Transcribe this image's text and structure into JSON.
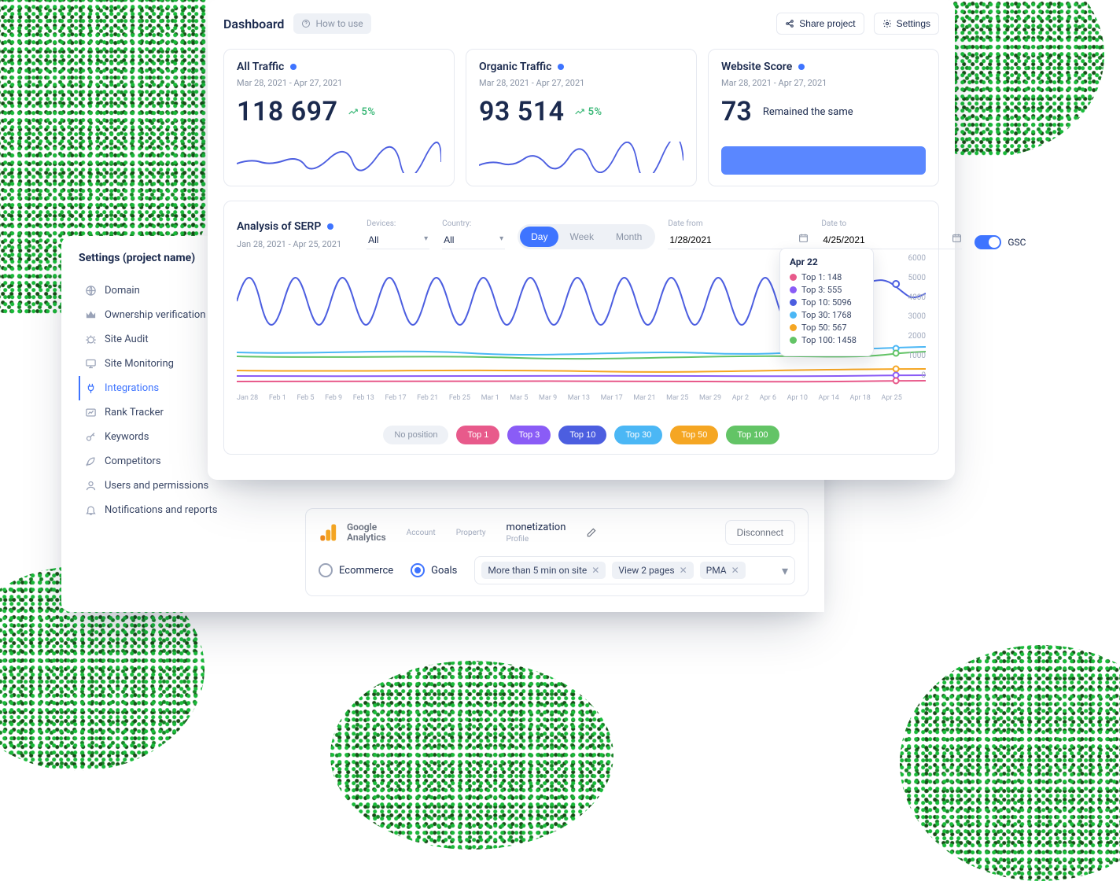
{
  "dashboard": {
    "title": "Dashboard",
    "how_to_use": "How to use",
    "share": "Share project",
    "settings": "Settings"
  },
  "metrics": {
    "all_traffic": {
      "title": "All Traffic",
      "date": "Mar 28, 2021 - Apr 27, 2021",
      "value": "118 697",
      "trend": "5%"
    },
    "organic_traffic": {
      "title": "Organic Traffic",
      "date": "Mar 28, 2021 - Apr 27, 2021",
      "value": "93 514",
      "trend": "5%"
    },
    "score": {
      "title": "Website Score",
      "date": "Mar 28, 2021 - Apr 27, 2021",
      "value": "73",
      "status": "Remained the same"
    }
  },
  "serp": {
    "title": "Analysis of SERP",
    "date_range": "Jan 28, 2021 - Apr 25, 2021",
    "filters": {
      "devices_label": "Devices:",
      "devices_value": "All",
      "country_label": "Country:",
      "country_value": "All",
      "date_from_label": "Date from",
      "date_from_value": "1/28/2021",
      "date_to_label": "Date to",
      "date_to_value": "4/25/2021",
      "gsc_label": "GSC",
      "period": {
        "day": "Day",
        "week": "Week",
        "month": "Month"
      }
    },
    "tooltip": {
      "date": "Apr 22",
      "items": [
        {
          "label": "Top 1: 148",
          "color": "#e85a8b"
        },
        {
          "label": "Top 3: 555",
          "color": "#8a5cf6"
        },
        {
          "label": "Top 10: 5096",
          "color": "#4c5ee0"
        },
        {
          "label": "Top 30: 1768",
          "color": "#4bb7f5"
        },
        {
          "label": "Top 50: 567",
          "color": "#f5a623"
        },
        {
          "label": "Top 100: 1458",
          "color": "#63c466"
        }
      ]
    },
    "yaxis": [
      "6000",
      "5000",
      "4000",
      "3000",
      "2000",
      "1000",
      "0"
    ],
    "xaxis": [
      "Jan 28",
      "Feb 1",
      "Feb 5",
      "Feb 9",
      "Feb 13",
      "Feb 17",
      "Feb 21",
      "Feb 25",
      "Mar 1",
      "Mar 5",
      "Mar 9",
      "Mar 13",
      "Mar 17",
      "Mar 21",
      "Mar 25",
      "Mar 29",
      "Apr 2",
      "Apr 6",
      "Apr 10",
      "Apr 14",
      "Apr 18",
      "Apr 25"
    ],
    "legend": {
      "no_position": "No position",
      "top1": "Top 1",
      "top3": "Top 3",
      "top10": "Top 10",
      "top30": "Top 30",
      "top50": "Top 50",
      "top100": "Top 100"
    }
  },
  "chart_data": {
    "type": "line",
    "title": "Analysis of SERP",
    "xlabel": "",
    "ylabel": "",
    "ylim": [
      0,
      6000
    ],
    "x": [
      "Jan 28",
      "Feb 1",
      "Feb 5",
      "Feb 9",
      "Feb 13",
      "Feb 17",
      "Feb 21",
      "Feb 25",
      "Mar 1",
      "Mar 5",
      "Mar 9",
      "Mar 13",
      "Mar 17",
      "Mar 21",
      "Mar 25",
      "Mar 29",
      "Apr 2",
      "Apr 6",
      "Apr 10",
      "Apr 14",
      "Apr 18",
      "Apr 22",
      "Apr 25"
    ],
    "series": [
      {
        "name": "Top 1",
        "color": "#e85a8b",
        "sample_value_apr22": 148
      },
      {
        "name": "Top 3",
        "color": "#8a5cf6",
        "sample_value_apr22": 555
      },
      {
        "name": "Top 10",
        "color": "#4c5ee0",
        "sample_value_apr22": 5096
      },
      {
        "name": "Top 30",
        "color": "#4bb7f5",
        "sample_value_apr22": 1768
      },
      {
        "name": "Top 50",
        "color": "#f5a623",
        "sample_value_apr22": 567
      },
      {
        "name": "Top 100",
        "color": "#63c466",
        "sample_value_apr22": 1458
      }
    ]
  },
  "settings": {
    "title": "Settings (project name)",
    "nav": [
      "Domain",
      "Ownership verification",
      "Site Audit",
      "Site Monitoring",
      "Integrations",
      "Rank Tracker",
      "Keywords",
      "Competitors",
      "Users and permissions",
      "Notifications and reports"
    ],
    "ga": {
      "logo_line1": "Google",
      "logo_line2": "Analytics",
      "account_label": "Account",
      "property_label": "Property",
      "profile_title": "monetization",
      "profile_label": "Profile",
      "disconnect": "Disconnect",
      "ecommerce": "Ecommerce",
      "goals": "Goals",
      "tags": [
        "More than 5 min on site",
        "View 2 pages",
        "PMA"
      ]
    }
  }
}
